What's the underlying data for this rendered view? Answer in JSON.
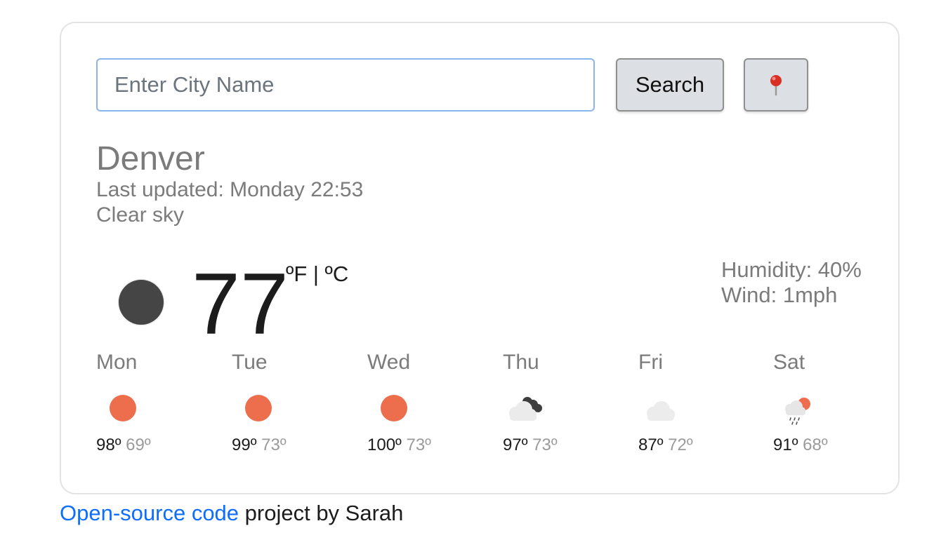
{
  "search": {
    "placeholder": "Enter City Name",
    "value": "",
    "button_label": "Search",
    "location_icon": "pushpin-icon"
  },
  "current": {
    "city": "Denver",
    "last_updated": "Last updated: Monday 22:53",
    "description": "Clear sky",
    "icon": "moon-icon",
    "temperature": "77",
    "unit_f": "ºF",
    "unit_sep": " | ",
    "unit_c": "ºC",
    "humidity": "Humidity: 40%",
    "wind": "Wind: 1mph"
  },
  "forecast": [
    {
      "day": "Mon",
      "icon": "sun-icon",
      "max": "98º",
      "min": "69º"
    },
    {
      "day": "Tue",
      "icon": "sun-icon",
      "max": "99º",
      "min": "73º"
    },
    {
      "day": "Wed",
      "icon": "sun-icon",
      "max": "100º",
      "min": "73º"
    },
    {
      "day": "Thu",
      "icon": "night-cloud-icon",
      "max": "97º",
      "min": "73º"
    },
    {
      "day": "Fri",
      "icon": "cloud-icon",
      "max": "87º",
      "min": "72º"
    },
    {
      "day": "Sat",
      "icon": "sun-rain-cloud-icon",
      "max": "91º",
      "min": "68º"
    }
  ],
  "footer": {
    "link_text": "Open-source code",
    "rest_text": " project by Sarah"
  },
  "colors": {
    "link": "#0d6efd",
    "sun": "#ec6e4c",
    "moon": "#454545",
    "muted_text": "#7b7b7b"
  }
}
